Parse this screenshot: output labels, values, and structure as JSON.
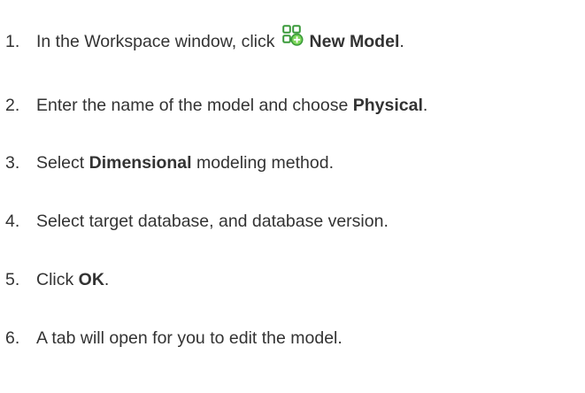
{
  "steps": [
    {
      "number": "1.",
      "text_before": "In the Workspace window, click",
      "icon": "new-model-icon",
      "bold": "New Model",
      "text_after": "."
    },
    {
      "number": "2.",
      "text_before": "Enter the name of the model and choose",
      "bold": "Physical",
      "text_after": "."
    },
    {
      "number": "3.",
      "text_before": "Select",
      "bold": "Dimensional",
      "text_after": "modeling method."
    },
    {
      "number": "4.",
      "text": "Select target database, and database version."
    },
    {
      "number": "5.",
      "text_before": "Click",
      "bold": "OK",
      "text_after": "."
    },
    {
      "number": "6.",
      "text": "A tab will open for you to edit the model."
    }
  ],
  "colors": {
    "text": "#333333",
    "icon_green": "#3a9a3a",
    "icon_plus_fill": "#7cd65a"
  }
}
